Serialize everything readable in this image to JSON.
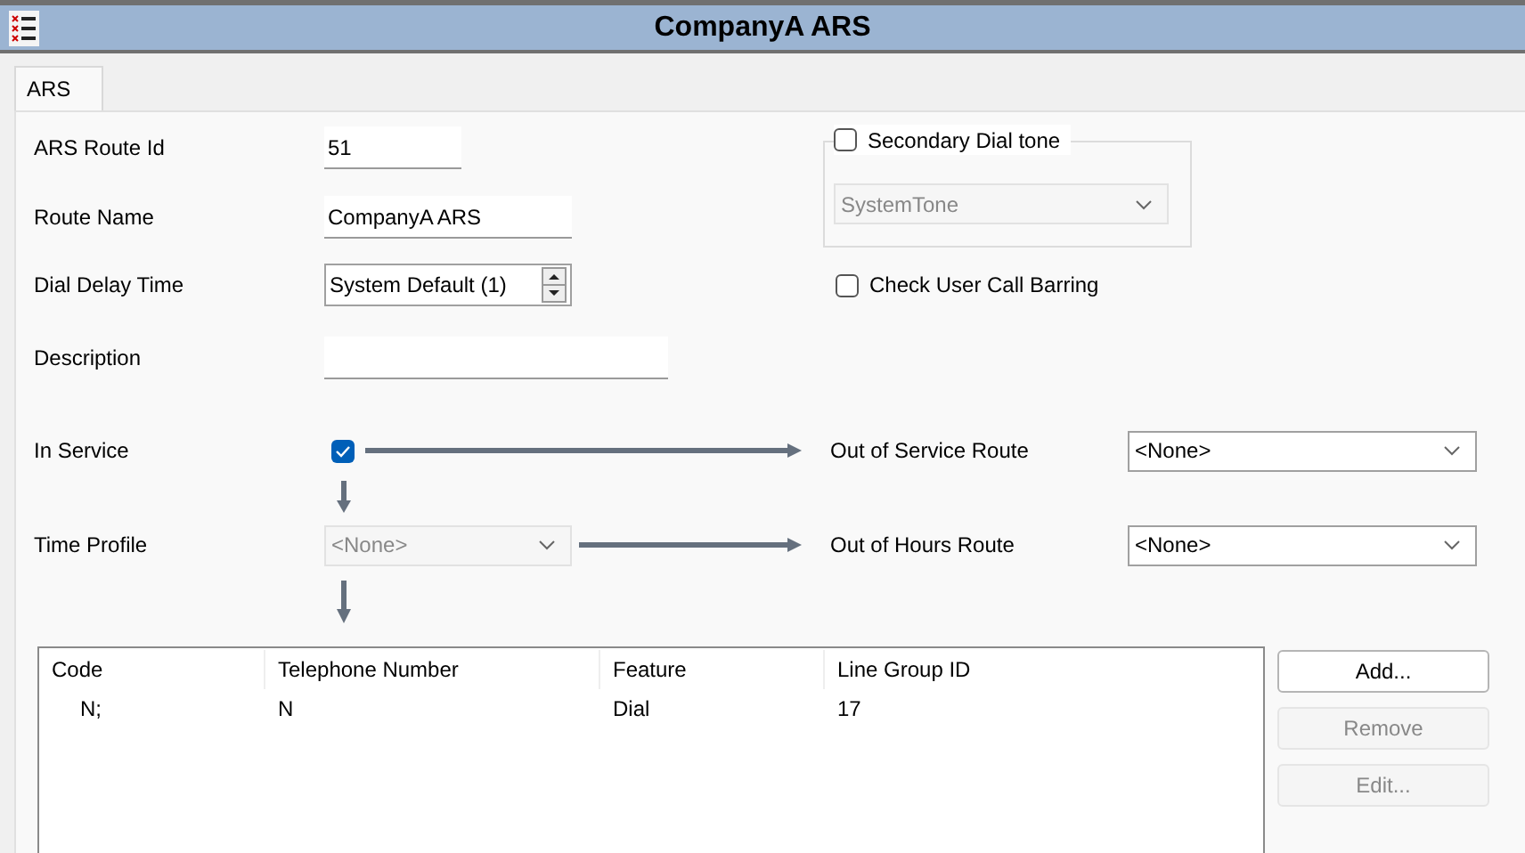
{
  "window": {
    "title": "CompanyA ARS"
  },
  "tabs": [
    {
      "label": "ARS",
      "selected": true
    }
  ],
  "fields": [
    {
      "label": "ARS Route Id",
      "kind": "text",
      "value": "51"
    },
    {
      "label": "Route Name",
      "kind": "text",
      "value": "CompanyA ARS"
    },
    {
      "label": "Dial Delay Time",
      "kind": "spin",
      "value": "System Default (1)"
    },
    {
      "label": "Description",
      "kind": "text"
    }
  ],
  "secondary_dial_tone": {
    "label": "Secondary Dial tone",
    "checked": false,
    "select": {
      "value": "SystemTone",
      "disabled": true
    }
  },
  "check_user_call_barring": {
    "label": "Check User Call Barring",
    "checked": false
  },
  "in_service": {
    "label": "In Service",
    "checked": true,
    "target_label": "Out of Service Route",
    "target_value": "<None>"
  },
  "time_profile": {
    "label": "Time Profile",
    "value": "<None>",
    "disabled": true,
    "target_label": "Out of Hours Route",
    "target_value": "<None>"
  },
  "table": {
    "columns": [
      "Code",
      "Telephone Number",
      "Feature",
      "Line Group ID"
    ],
    "rows": [
      [
        "N;",
        "N",
        "Dial",
        "17"
      ]
    ]
  },
  "buttons": [
    {
      "label": "Add...",
      "disabled": false
    },
    {
      "label": "Remove",
      "disabled": true
    },
    {
      "label": "Edit...",
      "disabled": true
    }
  ]
}
